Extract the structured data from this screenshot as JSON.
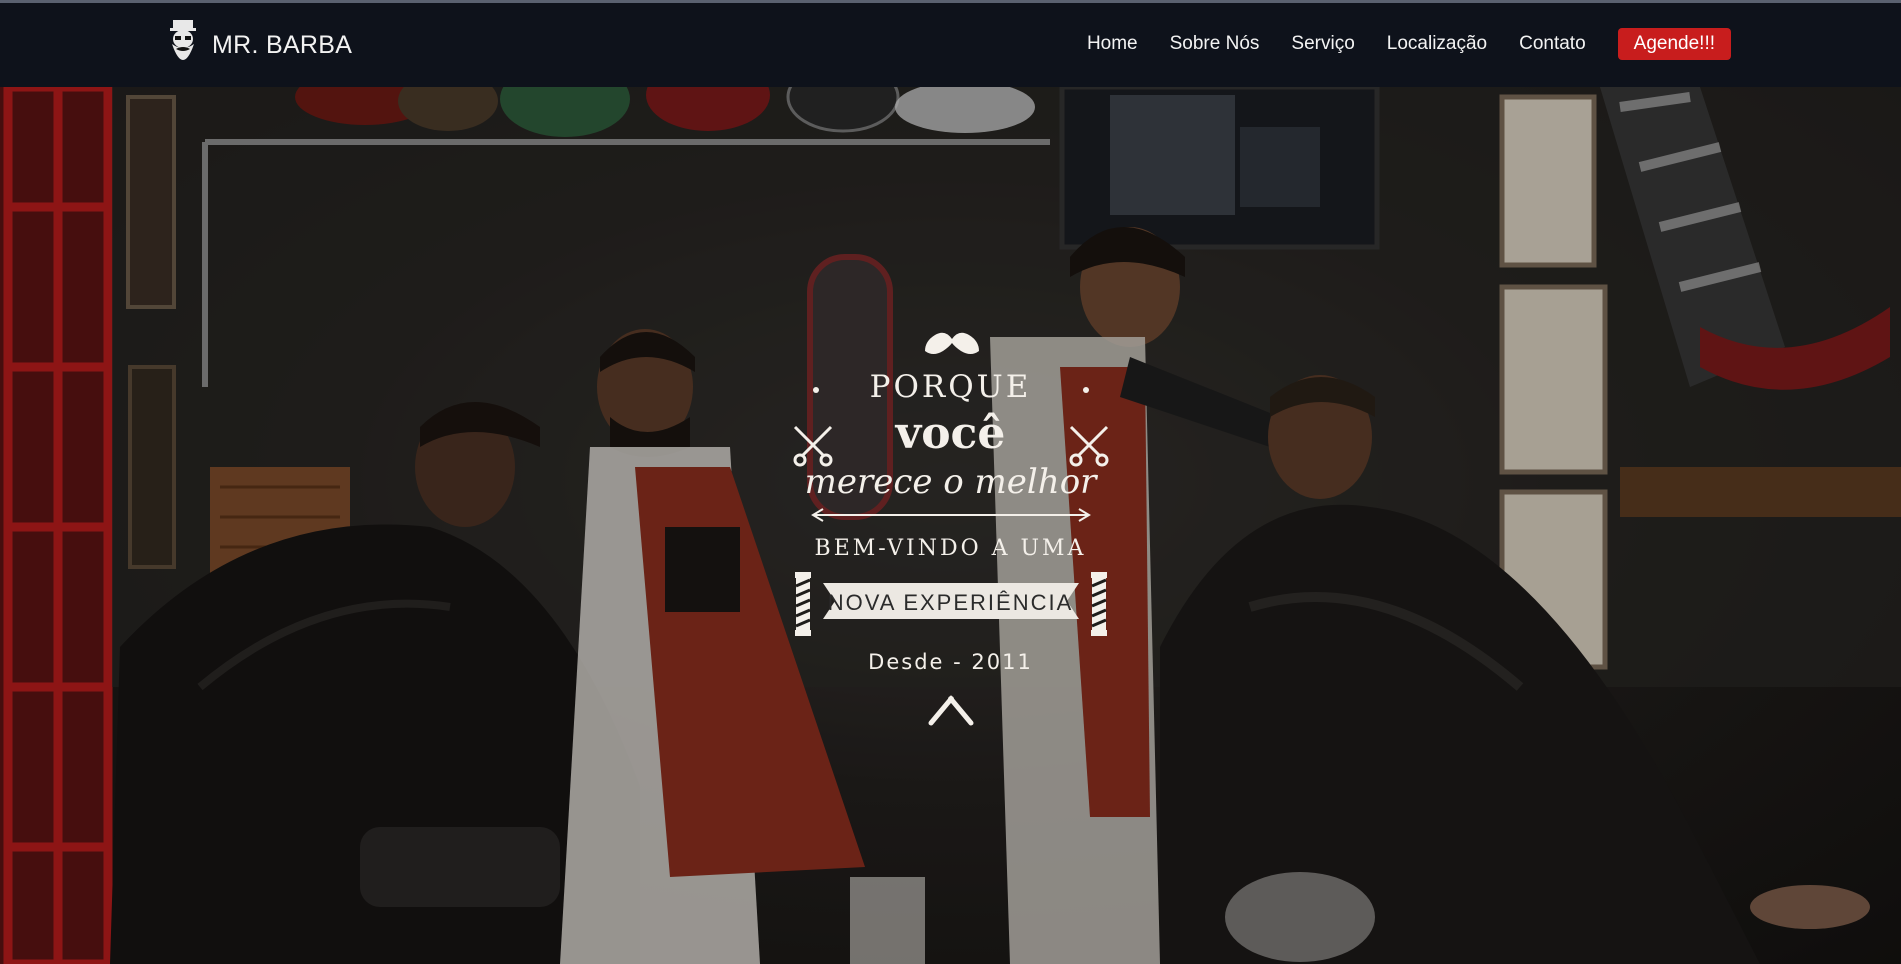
{
  "navbar": {
    "brand_name": "MR. BARBA",
    "brand_icon": "bearded-man-icon",
    "links": [
      {
        "label": "Home"
      },
      {
        "label": "Sobre Nós"
      },
      {
        "label": "Serviço"
      },
      {
        "label": "Localização"
      },
      {
        "label": "Contato"
      }
    ],
    "cta_label": "Agende!!!",
    "cta_color": "#c81d1d",
    "background_color": "#0e121b"
  },
  "hero": {
    "line1": "PORQUE",
    "line2": "você",
    "line3": "merece o melhor",
    "line4": "BEM-VINDO A UMA",
    "banner": "NOVA EXPERIÊNCIA",
    "since": "Desde - 2011",
    "icons": [
      "mustache-icon",
      "scissors-icon",
      "barber-pole-icon",
      "razor-icon"
    ]
  }
}
